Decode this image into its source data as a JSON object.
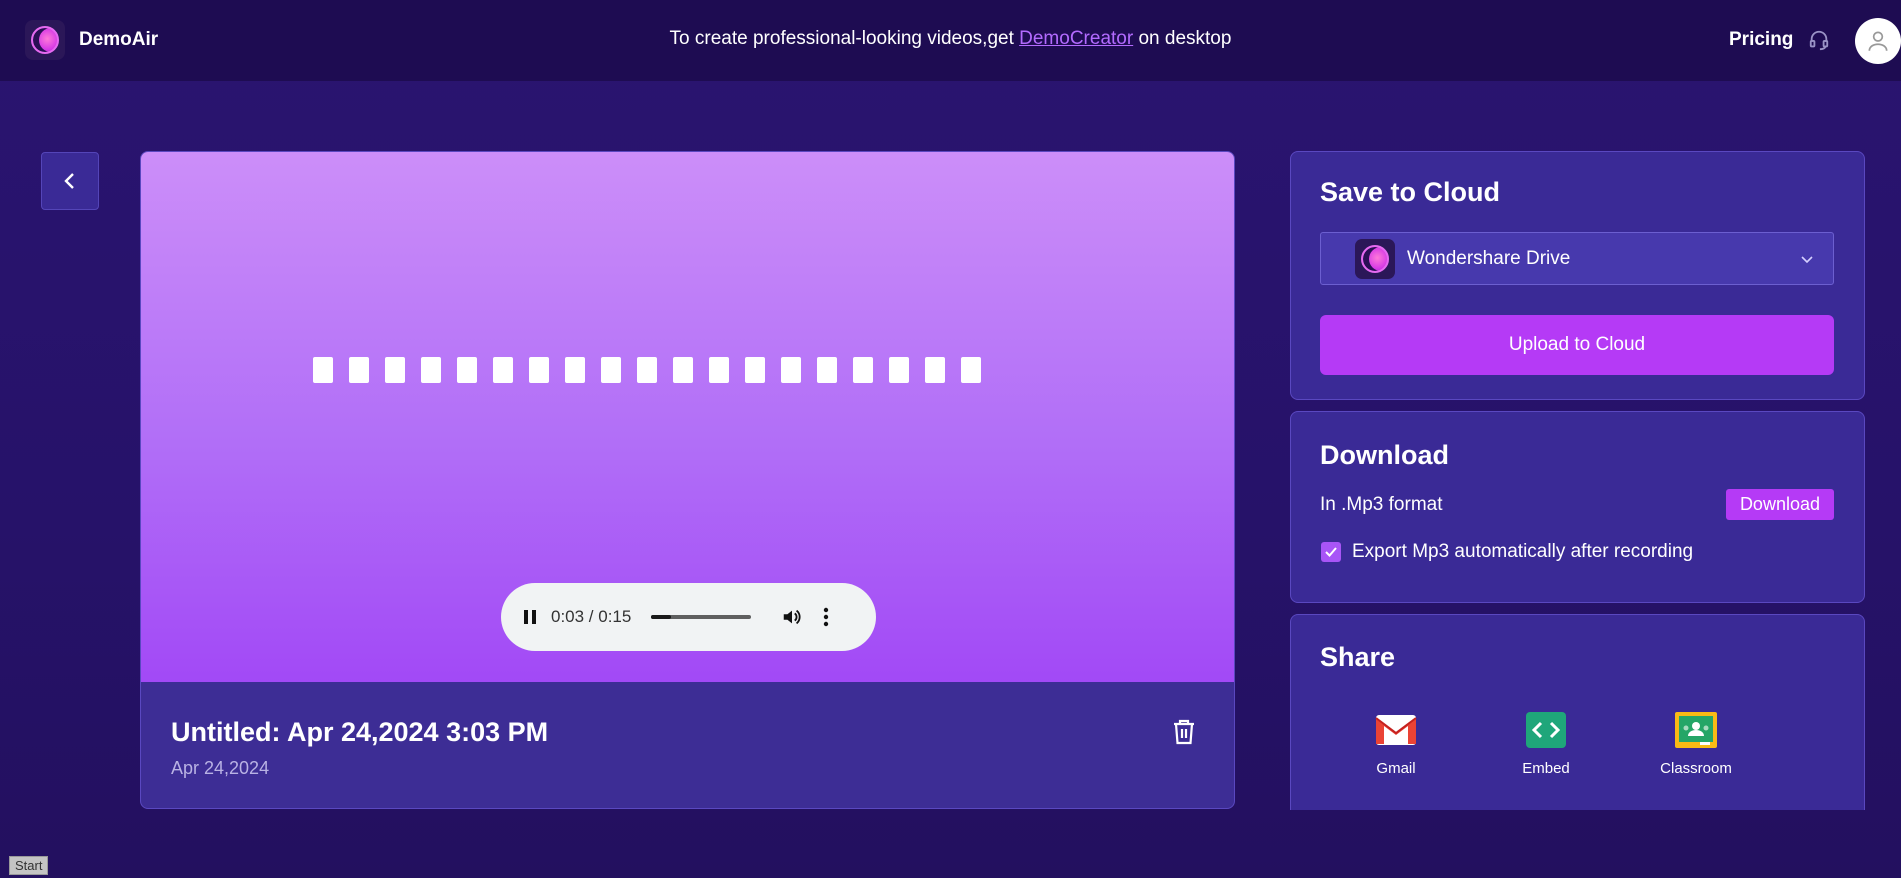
{
  "app": {
    "name": "DemoAir"
  },
  "header": {
    "promo_prefix": "To create professional-looking videos,get ",
    "promo_link": "DemoCreator",
    "promo_suffix": " on desktop",
    "pricing_label": "Pricing",
    "support_icon": "headset-icon",
    "avatar_icon": "user-avatar-icon"
  },
  "player": {
    "waveform_bar_count": 19,
    "current_time": "0:03",
    "duration": "0:15",
    "time_display": "0:03 / 0:15",
    "progress_fraction": 0.2,
    "is_playing": true
  },
  "recording": {
    "title": "Untitled: Apr 24,2024 3:03 PM",
    "date": "Apr 24,2024"
  },
  "save_to_cloud": {
    "heading": "Save to Cloud",
    "selected_drive": "Wondershare Drive",
    "upload_label": "Upload to Cloud"
  },
  "download": {
    "heading": "Download",
    "format_text": "In .Mp3 format",
    "button_label": "Download",
    "auto_export_label": "Export Mp3 automatically after recording",
    "auto_export_checked": true
  },
  "share": {
    "heading": "Share",
    "items": [
      {
        "label": "Gmail",
        "icon": "gmail-icon"
      },
      {
        "label": "Embed",
        "icon": "embed-icon"
      },
      {
        "label": "Classroom",
        "icon": "classroom-icon"
      }
    ]
  },
  "taskbar": {
    "start_label": "Start"
  },
  "colors": {
    "accent": "#b53af6",
    "link": "#b36bff",
    "topbar_bg": "#1e0c52",
    "panel_bg": "#3a2a96"
  }
}
